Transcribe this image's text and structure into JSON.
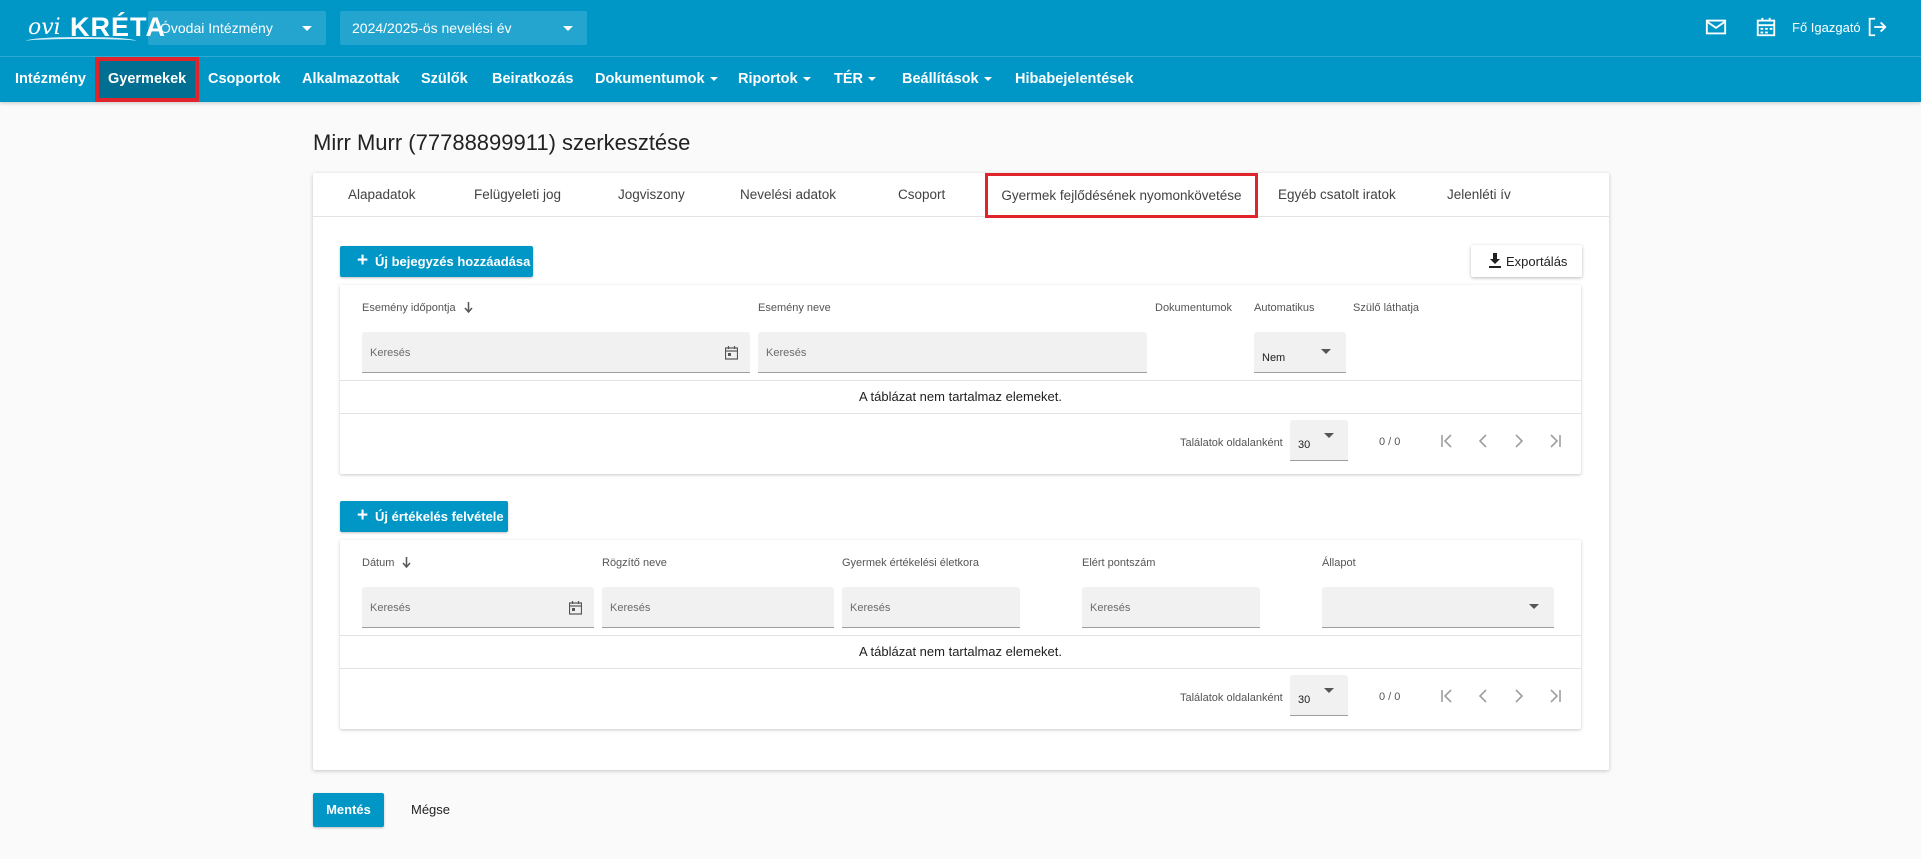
{
  "app": {
    "logo": {
      "prefix": "ovi",
      "name": "KRÉTA"
    },
    "institution_select": "Óvodai Intézmény",
    "year_select": "2024/2025-ös nevelési év",
    "user": "Fő Igazgató"
  },
  "nav": {
    "items": [
      {
        "label": "Intézmény"
      },
      {
        "label": "Gyermekek"
      },
      {
        "label": "Csoportok"
      },
      {
        "label": "Alkalmazottak"
      },
      {
        "label": "Szülők"
      },
      {
        "label": "Beiratkozás"
      },
      {
        "label": "Dokumentumok"
      },
      {
        "label": "Riportok"
      },
      {
        "label": "TÉR"
      },
      {
        "label": "Beállítások"
      },
      {
        "label": "Hibabejelentések"
      }
    ]
  },
  "page": {
    "title": "Mirr Murr (77788899911) szerkesztése"
  },
  "tabs": [
    {
      "label": "Alapadatok"
    },
    {
      "label": "Felügyeleti jog"
    },
    {
      "label": "Jogviszony"
    },
    {
      "label": "Nevelési adatok"
    },
    {
      "label": "Csoport"
    },
    {
      "label": "Gyermek fejlődésének nyomonkövetése"
    },
    {
      "label": "Egyéb csatolt iratok"
    },
    {
      "label": "Jelenléti ív"
    }
  ],
  "events": {
    "add_button": "Új bejegyzés hozzáadása",
    "export_button": "Exportálás",
    "columns": [
      "Esemény időpontja",
      "Esemény neve",
      "Dokumentumok",
      "Automatikus",
      "Szülő láthatja"
    ],
    "search_placeholder": "Keresés",
    "automatic_filter_value": "Nem",
    "empty_message": "A táblázat nem tartalmaz elemeket.",
    "pager": {
      "label": "Találatok oldalanként",
      "page_size": "30",
      "count": "0 / 0"
    }
  },
  "evaluations": {
    "add_button": "Új értékelés felvétele",
    "columns": [
      "Dátum",
      "Rögzítő neve",
      "Gyermek értékelési életkora",
      "Elért pontszám",
      "Állapot"
    ],
    "search_placeholder": "Keresés",
    "empty_message": "A táblázat nem tartalmaz elemeket.",
    "pager": {
      "label": "Találatok oldalanként",
      "page_size": "30",
      "count": "0 / 0"
    }
  },
  "footer": {
    "save": "Mentés",
    "cancel": "Mégse"
  },
  "colors": {
    "primary": "#0097c7",
    "nav_active": "#006f91",
    "highlight": "#e0242b"
  }
}
